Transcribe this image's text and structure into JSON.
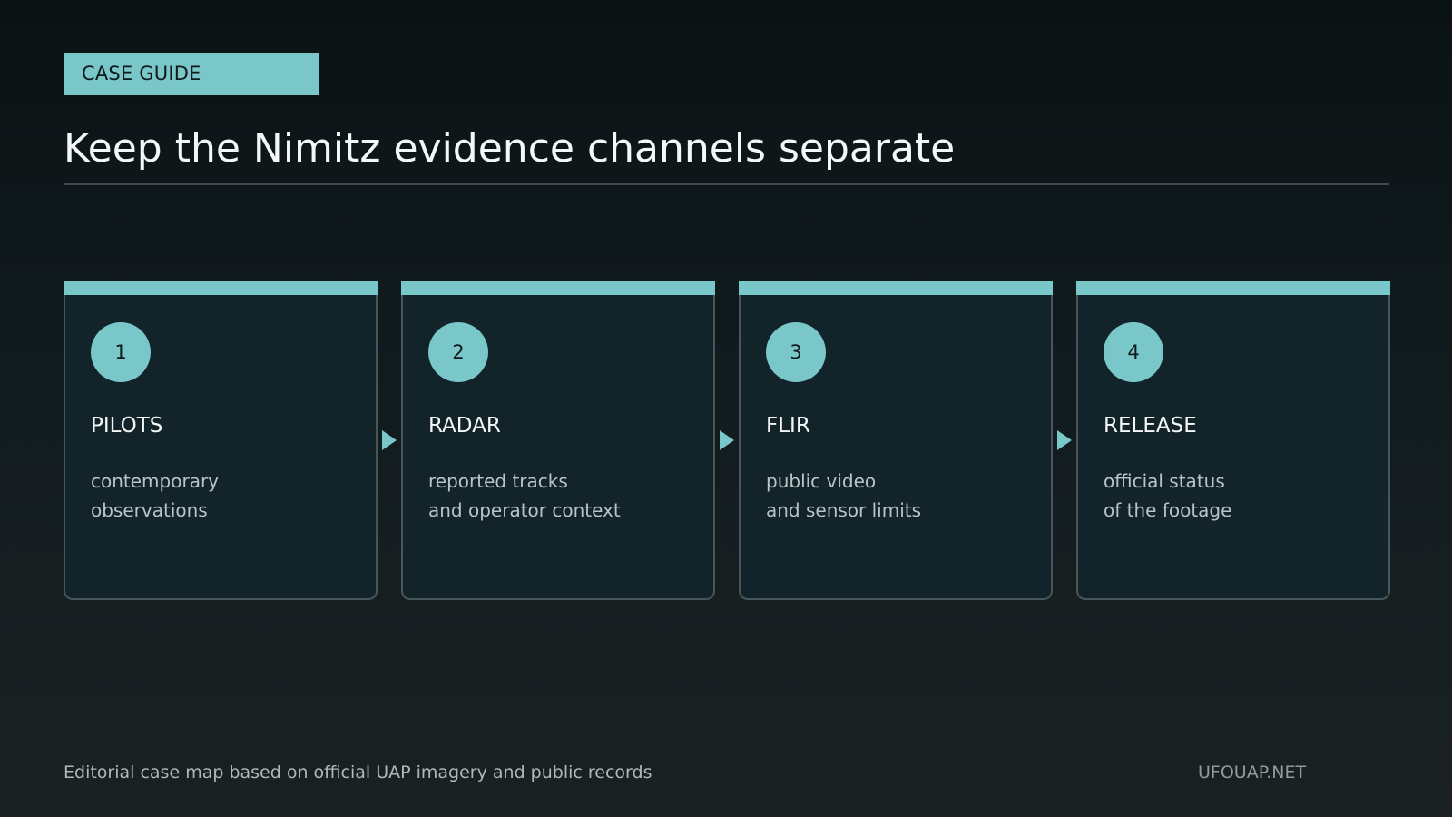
{
  "header": {
    "tag": "CASE GUIDE",
    "title": "Keep the Nimitz evidence channels separate"
  },
  "steps": [
    {
      "number": "1",
      "title": "PILOTS",
      "lines": [
        "contemporary",
        "observations"
      ]
    },
    {
      "number": "2",
      "title": "RADAR",
      "lines": [
        "reported tracks",
        "and operator context"
      ]
    },
    {
      "number": "3",
      "title": "FLIR",
      "lines": [
        "public video",
        "and sensor limits"
      ]
    },
    {
      "number": "4",
      "title": "RELEASE",
      "lines": [
        "official status",
        "of the footage"
      ]
    }
  ],
  "footer": {
    "note": "Editorial case map based on official UAP imagery and public records",
    "brand": "UFOUAP.NET"
  },
  "colors": {
    "accent": "#79c7c8",
    "card_background": "#12232a",
    "card_border": "#47565a",
    "page_background": "#111b1e"
  }
}
